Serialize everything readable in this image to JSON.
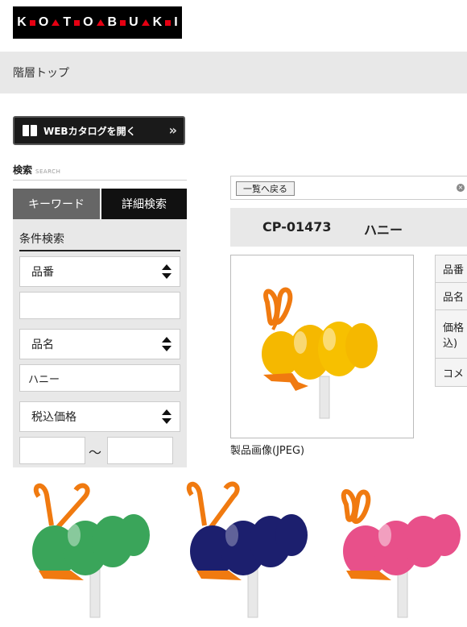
{
  "logo": {
    "letters": [
      "K",
      "O",
      "T",
      "O",
      "B",
      "U",
      "K",
      "I"
    ]
  },
  "breadcrumb": {
    "top": "階層トップ"
  },
  "sidebar": {
    "web_catalog_label": "WEBカタログを開く",
    "search_heading": "検索",
    "search_heading_en": "SEARCH",
    "tabs": [
      {
        "label": "キーワード"
      },
      {
        "label": "詳細検索"
      }
    ],
    "condition_title": "条件検索",
    "selects": [
      {
        "value": "品番"
      },
      {
        "value": "品名"
      },
      {
        "value": "税込価格"
      }
    ],
    "inputs": {
      "field1": "",
      "field2": "ハニー"
    },
    "range_separator": "～"
  },
  "main": {
    "back_label": "一覧へ戻る",
    "product_code": "CP-01473",
    "product_name": "ハニー",
    "image_caption": "製品画像(JPEG)",
    "spec_labels": [
      "品番",
      "品名",
      "価格",
      "込)",
      "コメ"
    ]
  },
  "colors": {
    "logo_accent": "#e60012",
    "yellow_body": "#f5b800",
    "green_body": "#3aa55a",
    "navy_body": "#1c1f6e",
    "pink_body": "#e8508a",
    "antenna_orange": "#f07a10"
  },
  "variants": [
    {
      "color": "#3aa55a",
      "shade": "#1f7a3d"
    },
    {
      "color": "#1c1f6e",
      "shade": "#0d0f45"
    },
    {
      "color": "#e8508a",
      "shade": "#b22c66"
    }
  ]
}
